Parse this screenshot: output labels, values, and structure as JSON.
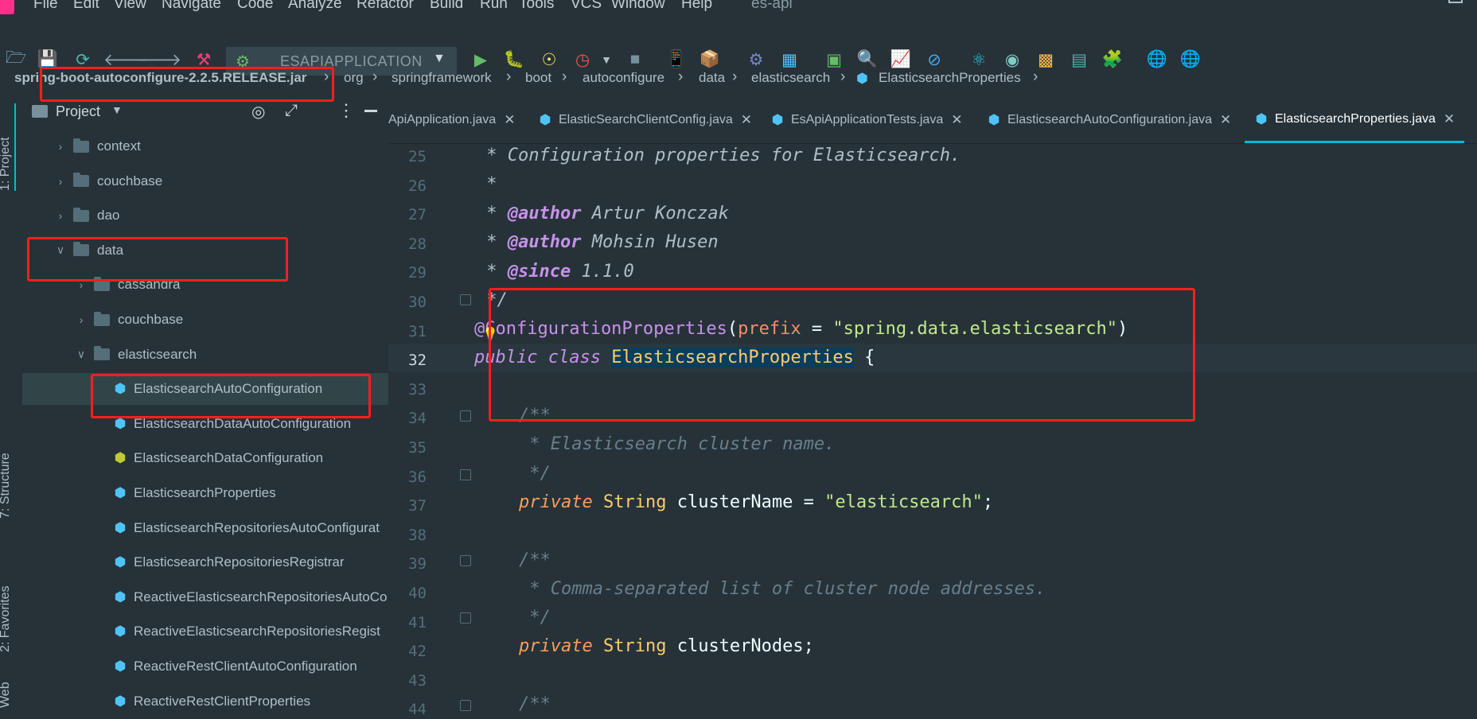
{
  "menubar": {
    "items": [
      "File",
      "Edit",
      "View",
      "Navigate",
      "Code",
      "Analyze",
      "Refactor",
      "Build",
      "Run",
      "Tools",
      "VCS",
      "Window",
      "Help"
    ],
    "project_name": "es-api"
  },
  "toolbar": {
    "run_config": "ESAPIAPPLICATION"
  },
  "breadcrumb": {
    "items": [
      "spring-boot-autoconfigure-2.2.5.RELEASE.jar",
      "org",
      "springframework",
      "boot",
      "autoconfigure",
      "data",
      "elasticsearch",
      "ElasticsearchProperties"
    ]
  },
  "left_strip": {
    "project_tab": "1: Project",
    "structure_tab": "7: Structure",
    "favorites_tab": "2: Favorites",
    "web_tab": "Web"
  },
  "project_panel": {
    "title": "Project",
    "tree": [
      {
        "label": "context",
        "kind": "folder",
        "depth": 1,
        "expanded": false
      },
      {
        "label": "couchbase",
        "kind": "folder",
        "depth": 1,
        "expanded": false
      },
      {
        "label": "dao",
        "kind": "folder",
        "depth": 1,
        "expanded": false
      },
      {
        "label": "data",
        "kind": "folder",
        "depth": 1,
        "expanded": true
      },
      {
        "label": "cassandra",
        "kind": "folder",
        "depth": 2,
        "expanded": false
      },
      {
        "label": "couchbase",
        "kind": "folder",
        "depth": 2,
        "expanded": false
      },
      {
        "label": "elasticsearch",
        "kind": "folder",
        "depth": 2,
        "expanded": true
      },
      {
        "label": "ElasticsearchAutoConfiguration",
        "kind": "class",
        "depth": 3,
        "selected": true
      },
      {
        "label": "ElasticsearchDataAutoConfiguration",
        "kind": "class",
        "depth": 3
      },
      {
        "label": "ElasticsearchDataConfiguration",
        "kind": "class-green",
        "depth": 3
      },
      {
        "label": "ElasticsearchProperties",
        "kind": "class",
        "depth": 3
      },
      {
        "label": "ElasticsearchRepositoriesAutoConfigurat",
        "kind": "class",
        "depth": 3
      },
      {
        "label": "ElasticsearchRepositoriesRegistrar",
        "kind": "class",
        "depth": 3
      },
      {
        "label": "ReactiveElasticsearchRepositoriesAutoCo",
        "kind": "class",
        "depth": 3
      },
      {
        "label": "ReactiveElasticsearchRepositoriesRegist",
        "kind": "class",
        "depth": 3
      },
      {
        "label": "ReactiveRestClientAutoConfiguration",
        "kind": "class",
        "depth": 3
      },
      {
        "label": "ReactiveRestClientProperties",
        "kind": "class",
        "depth": 3
      }
    ]
  },
  "editor": {
    "tabs": [
      {
        "label": "ApiApplication.java",
        "active": false
      },
      {
        "label": "ElasticSearchClientConfig.java",
        "active": false
      },
      {
        "label": "EsApiApplicationTests.java",
        "active": false
      },
      {
        "label": "ElasticsearchAutoConfiguration.java",
        "active": false
      },
      {
        "label": "ElasticsearchProperties.java",
        "active": true
      }
    ],
    "line_numbers": [
      "25",
      "26",
      "27",
      "28",
      "29",
      "30",
      "31",
      "32",
      "33",
      "34",
      "35",
      "36",
      "37",
      "38",
      "39",
      "40",
      "41",
      "42",
      "43",
      "44"
    ],
    "current_line": "32",
    "code": {
      "l25": " * Configuration properties for Elasticsearch.",
      "l26": " *",
      "l27_tag": "@author",
      "l27_text": " Artur Konczak",
      "l28_tag": "@author",
      "l28_text": " Mohsin Husen",
      "l29_tag": "@since",
      "l29_text": " 1.1.0",
      "l30": " */",
      "l31_ann": "@ConfigurationProperties",
      "l31_param": "prefix",
      "l31_str": "\"spring.data.elasticsearch\"",
      "l32_kw1": "public",
      "l32_kw2": "class",
      "l32_name": "ElasticsearchProperties",
      "l34": "/**",
      "l35": " * Elasticsearch cluster name.",
      "l36": " */",
      "l37_kw": "private",
      "l37_type": "String",
      "l37_name": "clusterName",
      "l37_str": "\"elasticsearch\"",
      "l39": "/**",
      "l40": " * Comma-separated list of cluster node addresses.",
      "l41": " */",
      "l42_kw": "private",
      "l42_type": "String",
      "l42_name": "clusterNodes",
      "l44": "/**"
    }
  }
}
